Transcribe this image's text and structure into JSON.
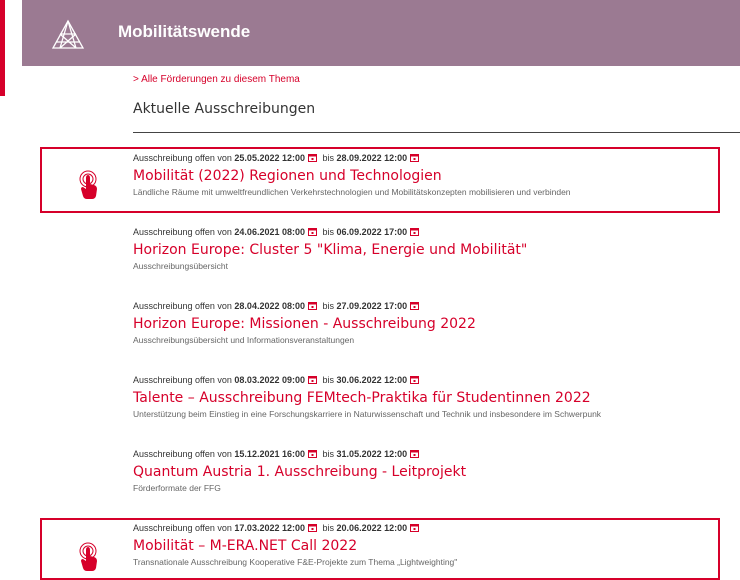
{
  "header": {
    "title": "Mobilitätswende",
    "logo_icon": "triangle-network-logo-icon"
  },
  "all_link": "> Alle Förderungen zu diesem Thema",
  "section_heading": "Aktuelle Ausschreibungen",
  "labels": {
    "open_from": "Ausschreibung offen von",
    "until": "bis"
  },
  "entries": [
    {
      "from": "25.05.2022 12:00",
      "to": "28.09.2022 12:00",
      "title": "Mobilität (2022) Regionen und Technologien",
      "subtitle": "Ländliche Räume mit umweltfreundlichen Verkehrstechnologien und Mobilitätskonzepten mobilisieren und verbinden"
    },
    {
      "from": "24.06.2021 08:00",
      "to": "06.09.2022 17:00",
      "title": "Horizon Europe: Cluster 5 \"Klima, Energie und Mobilität\"",
      "subtitle": "Ausschreibungsübersicht"
    },
    {
      "from": "28.04.2022 08:00",
      "to": "27.09.2022 17:00",
      "title": "Horizon Europe: Missionen - Ausschreibung 2022",
      "subtitle": "Ausschreibungsübersicht und Informationsveranstaltungen"
    },
    {
      "from": "08.03.2022 09:00",
      "to": "30.06.2022 12:00",
      "title": "Talente – Ausschreibung FEMtech-Praktika für Studentinnen 2022",
      "subtitle": "Unterstützung beim Einstieg in eine Forschungskarriere in Naturwissenschaft und Technik und insbesondere im Schwerpunk"
    },
    {
      "from": "15.12.2021 16:00",
      "to": "31.05.2022 12:00",
      "title": "Quantum Austria 1. Ausschreibung - Leitprojekt",
      "subtitle": "Förderformate der FFG"
    },
    {
      "from": "17.03.2022 12:00",
      "to": "20.06.2022 12:00",
      "title": "Mobilität – M-ERA.NET Call 2022",
      "subtitle": "Transnationale Ausschreibung Kooperative F&E-Projekte zum Thema „Lightweighting\""
    }
  ],
  "colors": {
    "header_bg": "#9b7a92",
    "accent": "#d6002a"
  },
  "icons": {
    "calendar": "calendar-icon",
    "pointer": "hand-pointer-icon"
  }
}
